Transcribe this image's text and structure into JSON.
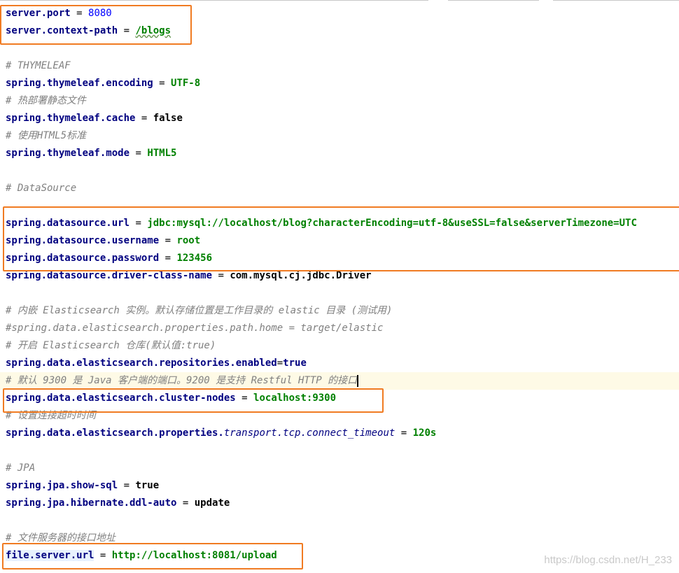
{
  "lines": [
    {
      "t": "kv",
      "key": "server.port",
      "val": "8080",
      "vc": "num"
    },
    {
      "t": "kv",
      "key": "server.context-path",
      "val": "/blogs",
      "vc": "str",
      "under": true
    },
    {
      "t": "blank"
    },
    {
      "t": "c",
      "text": "# THYMELEAF"
    },
    {
      "t": "kv",
      "key": "spring.thymeleaf.encoding",
      "val": "UTF-8",
      "vc": "str"
    },
    {
      "t": "c",
      "text": "# 热部署静态文件"
    },
    {
      "t": "kv",
      "key": "spring.thymeleaf.cache",
      "val": "false",
      "vc": "plain"
    },
    {
      "t": "c",
      "text": "# 使用HTML5标准"
    },
    {
      "t": "kv",
      "key": "spring.thymeleaf.mode",
      "val": "HTML5",
      "vc": "str"
    },
    {
      "t": "blank"
    },
    {
      "t": "c",
      "text": "# DataSource"
    },
    {
      "t": "blank"
    },
    {
      "t": "kv",
      "key": "spring.datasource.url",
      "val": "jdbc:mysql://localhost/blog?characterEncoding=utf-8&useSSL=false&serverTimezone=UTC",
      "vc": "str"
    },
    {
      "t": "kv",
      "key": "spring.datasource.username",
      "val": "root",
      "vc": "str"
    },
    {
      "t": "kv",
      "key": "spring.datasource.password",
      "val": "123456",
      "vc": "str"
    },
    {
      "t": "kv",
      "key": "spring.datasource.driver-class-name",
      "val": "com.mysql.cj.jdbc.Driver",
      "vc": "plain"
    },
    {
      "t": "blank"
    },
    {
      "t": "c",
      "text": "# 内嵌 Elasticsearch 实例。默认存储位置是工作目录的 elastic 目录 (测试用)"
    },
    {
      "t": "c",
      "text": "#spring.data.elasticsearch.properties.path.home = target/elastic"
    },
    {
      "t": "c",
      "text": "# 开启 Elasticsearch 仓库(默认值:true)"
    },
    {
      "t": "kvraw",
      "key": "spring.data.elasticsearch.repositories.enabled",
      "val": "true"
    },
    {
      "t": "c",
      "text": "# 默认 9300 是 Java 客户端的端口。9200 是支持 Restful HTTP 的接口",
      "current": true,
      "caret": true
    },
    {
      "t": "kv",
      "key": "spring.data.elasticsearch.cluster-nodes",
      "val": "localhost:9300",
      "vc": "str"
    },
    {
      "t": "c",
      "text": "# 设置连接超时时间"
    },
    {
      "t": "kvital",
      "key": "spring.data.elasticsearch.properties.",
      "ikey": "transport.tcp.connect_timeout",
      "val": "120s",
      "vc": "str"
    },
    {
      "t": "blank"
    },
    {
      "t": "c",
      "text": "# JPA"
    },
    {
      "t": "kv",
      "key": "spring.jpa.show-sql",
      "val": "true",
      "vc": "plain"
    },
    {
      "t": "kv",
      "key": "spring.jpa.hibernate.ddl-auto",
      "val": "update",
      "vc": "plain"
    },
    {
      "t": "blank"
    },
    {
      "t": "c",
      "text": "# 文件服务器的接口地址"
    },
    {
      "t": "kv",
      "key": "file.server.url",
      "val": "http://localhost:8081/upload",
      "vc": "str",
      "hl": true
    }
  ],
  "watermark": "https://blog.csdn.net/H_233"
}
